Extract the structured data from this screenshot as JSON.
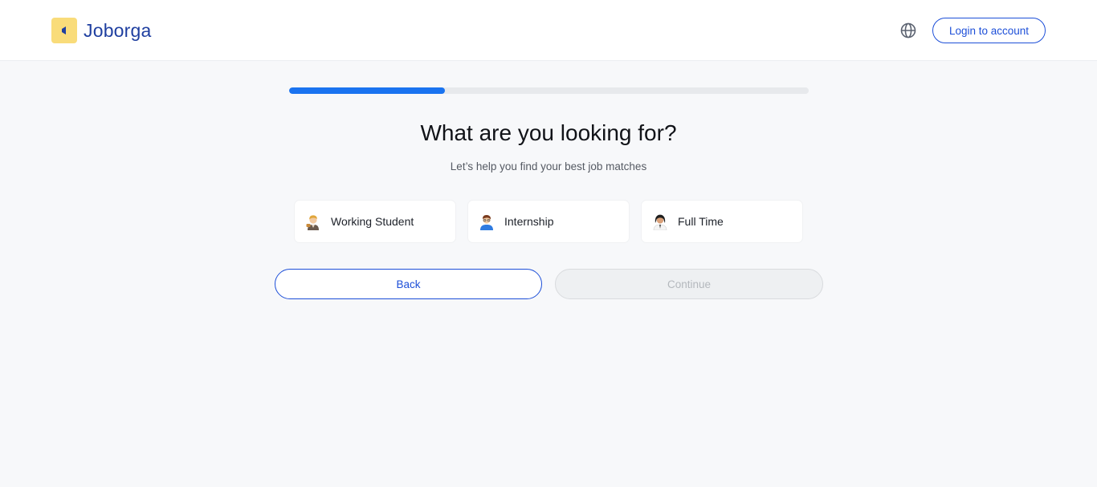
{
  "header": {
    "brand": "Joborga",
    "brand_color": "#1f3fa0",
    "logo_bg": "#f9dc7a",
    "language_icon": "globe-icon",
    "login_label": "Login to account"
  },
  "progress": {
    "fraction": 0.3,
    "color": "#1a73f0"
  },
  "main": {
    "title": "What are you looking for?",
    "subtitle": "Let’s help you find your best job matches"
  },
  "options": [
    {
      "label": "Working Student",
      "icon": "working-student-avatar-icon"
    },
    {
      "label": "Internship",
      "icon": "internship-avatar-icon"
    },
    {
      "label": "Full Time",
      "icon": "full-time-avatar-icon"
    }
  ],
  "actions": {
    "back_label": "Back",
    "continue_label": "Continue",
    "continue_disabled": true,
    "accent": "#1d4fd8"
  }
}
